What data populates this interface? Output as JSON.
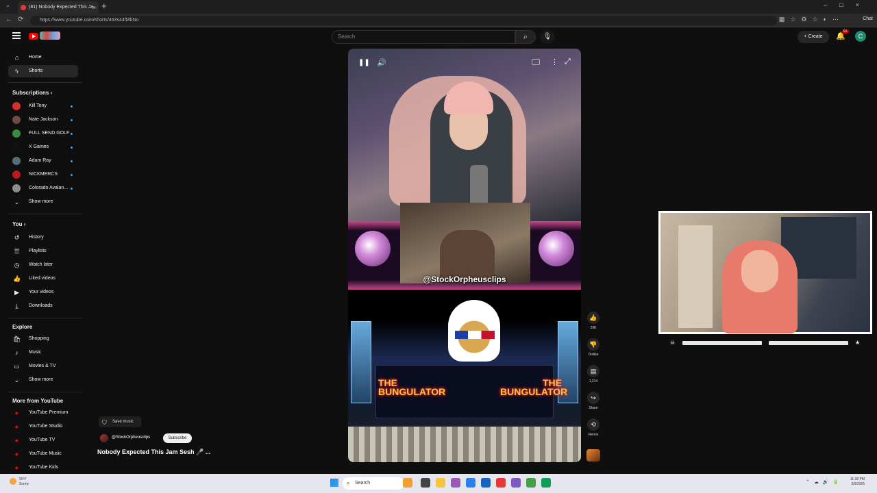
{
  "browser": {
    "tab_title": "(81) Nobody Expected This Ja...",
    "url": "https://www.youtube.com/shorts/463s44fMbNo",
    "chat_label": "Chat"
  },
  "header": {
    "search_placeholder": "Search",
    "create_label": "Create",
    "notification_count": "9+",
    "avatar_letter": "C"
  },
  "sidebar": {
    "primary": [
      {
        "label": "Home",
        "icon": "home-icon"
      },
      {
        "label": "Shorts",
        "icon": "shorts-icon",
        "active": true
      }
    ],
    "subscriptions_heading": "Subscriptions",
    "subscriptions": [
      {
        "label": "Kill Tony",
        "color": "#d32f2f"
      },
      {
        "label": "Nate Jackson",
        "color": "#6d4c41"
      },
      {
        "label": "FULL SEND GOLF",
        "color": "#388e3c"
      },
      {
        "label": "X Games",
        "color": "#111111"
      },
      {
        "label": "Adam Ray",
        "color": "#546e7a"
      },
      {
        "label": "NICKMERCS",
        "color": "#b71c1c"
      },
      {
        "label": "Colorado Avalan...",
        "color": "#8e8e8e"
      }
    ],
    "show_more_1": "Show more",
    "you_heading": "You",
    "you_items": [
      {
        "label": "History",
        "icon": "history-icon"
      },
      {
        "label": "Playlists",
        "icon": "playlists-icon"
      },
      {
        "label": "Watch later",
        "icon": "watch-later-icon"
      },
      {
        "label": "Liked videos",
        "icon": "liked-icon"
      },
      {
        "label": "Your videos",
        "icon": "your-videos-icon"
      },
      {
        "label": "Downloads",
        "icon": "download-icon"
      }
    ],
    "explore_heading": "Explore",
    "explore_items": [
      {
        "label": "Shopping",
        "icon": "shopping-icon"
      },
      {
        "label": "Music",
        "icon": "music-icon"
      },
      {
        "label": "Movies & TV",
        "icon": "movies-icon"
      }
    ],
    "show_more_2": "Show more",
    "more_heading": "More from YouTube",
    "more_items": [
      {
        "label": "YouTube Premium"
      },
      {
        "label": "YouTube Studio"
      },
      {
        "label": "YouTube TV"
      },
      {
        "label": "YouTube Music"
      },
      {
        "label": "YouTube Kids"
      }
    ]
  },
  "short": {
    "overlay_handle": "@StockOrpheusclips",
    "game_text_left": "THE BUNGULATOR",
    "game_text_right": "THE BUNGULATOR",
    "save_music": "Save music",
    "channel": "@StockOrpheusclips",
    "subscribe": "Subscribe",
    "title": "Nobody Expected This Jam Sesh 🎤 ..."
  },
  "actions": {
    "like_count": "29K",
    "dislike_label": "Dislike",
    "comment_count": "1,214",
    "share_label": "Share",
    "remix_label": "Remix"
  },
  "taskbar": {
    "weather_temp": "50°F",
    "weather_desc": "Sunny",
    "search_label": "Search",
    "time": "11:38 PM",
    "date": "3/9/2026"
  }
}
